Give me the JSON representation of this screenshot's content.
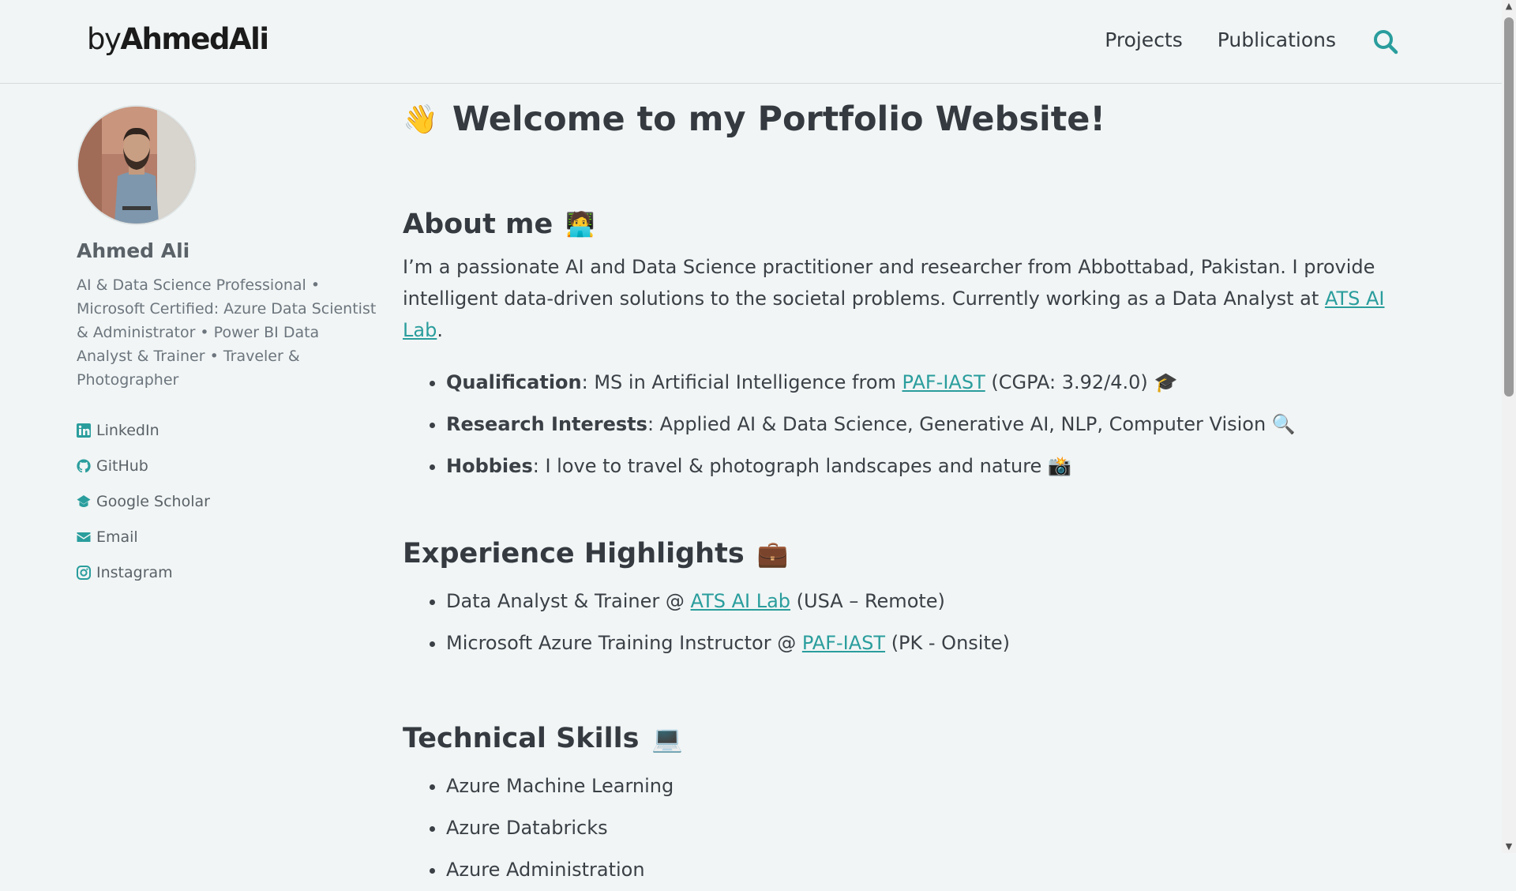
{
  "nav": {
    "brand_prefix": "by",
    "brand_name": "AhmedAli",
    "links": [
      "Projects",
      "Publications"
    ]
  },
  "sidebar": {
    "name": "Ahmed Ali",
    "bio": "AI & Data Science Professional • Microsoft Certified: Azure Data Scientist & Administrator • Power BI Data Analyst & Trainer • Traveler & Photographer",
    "links": [
      "LinkedIn",
      "GitHub",
      "Google Scholar",
      "Email",
      "Instagram"
    ]
  },
  "main": {
    "title": "Welcome to my Portfolio Website!",
    "about_heading": "About me",
    "about_text_1": "I’m a passionate AI and Data Science practitioner and researcher from Abbottabad, Pakistan. I provide intelligent data-driven solutions to the societal problems. Currently working as a Data Analyst at ",
    "about_link": "ATS AI Lab",
    "about_text_2": ".",
    "bullets": [
      {
        "label": "Qualification",
        "text": ": MS in Artificial Intelligence from ",
        "link": "PAF-IAST",
        "after": " (CGPA: 3.92/4.0)"
      },
      {
        "label": "Research Interests",
        "text": ": Applied AI & Data Science, Generative AI, NLP, Computer Vision"
      },
      {
        "label": "Hobbies",
        "text": ": I love to travel & photograph landscapes and nature"
      }
    ],
    "experience_heading": "Experience Highlights",
    "experience": [
      {
        "text": "Data Analyst & Trainer @ ",
        "link": "ATS AI Lab",
        "after": " (USA – Remote)"
      },
      {
        "text": "Microsoft Azure Training Instructor @ ",
        "link": "PAF-IAST",
        "after": " (PK - Onsite)"
      }
    ],
    "skills_heading": "Technical Skills",
    "skills": [
      "Azure Machine Learning",
      "Azure Databricks",
      "Azure Administration"
    ]
  },
  "colors": {
    "accent": "#2a9d9d",
    "background": "#f1f5f5",
    "text": "#343a40"
  },
  "icons": [
    "search-icon",
    "linkedin-icon",
    "github-icon",
    "graduation-cap-icon",
    "envelope-icon",
    "instagram-icon"
  ]
}
